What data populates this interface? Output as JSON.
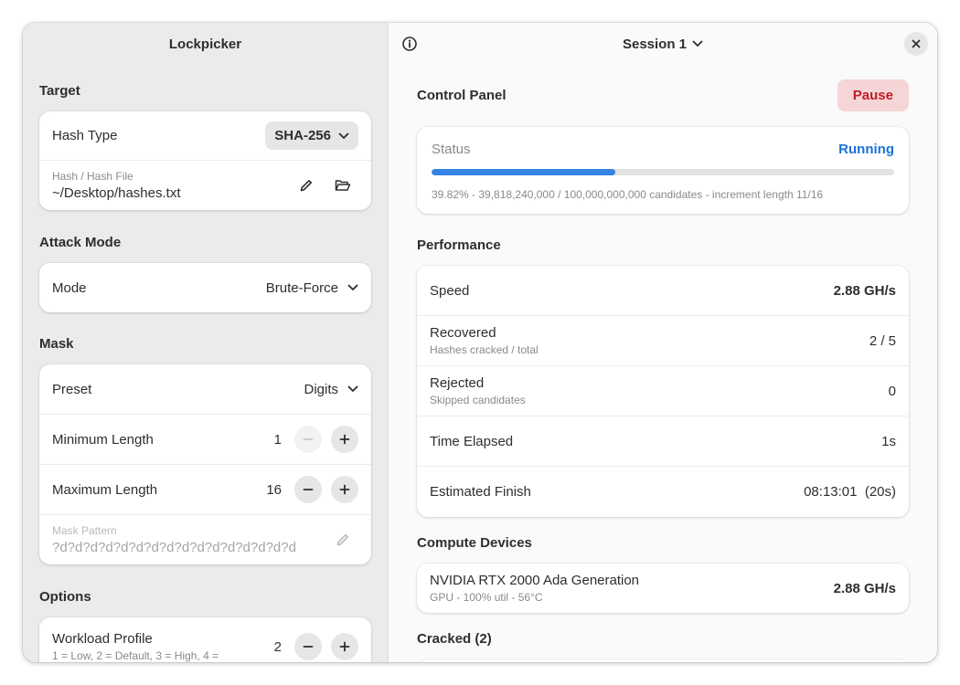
{
  "sidebar": {
    "title": "Lockpicker",
    "target": {
      "section_title": "Target",
      "hash_type_label": "Hash Type",
      "hash_type_value": "SHA-256",
      "hash_file_label": "Hash / Hash File",
      "hash_file_value": "~/Desktop/hashes.txt"
    },
    "attack": {
      "section_title": "Attack Mode",
      "mode_label": "Mode",
      "mode_value": "Brute-Force"
    },
    "mask": {
      "section_title": "Mask",
      "preset_label": "Preset",
      "preset_value": "Digits",
      "min_label": "Minimum Length",
      "min_value": "1",
      "max_label": "Maximum Length",
      "max_value": "16",
      "pattern_label": "Mask Pattern",
      "pattern_value": "?d?d?d?d?d?d?d?d?d?d?d?d?d?d?d?d"
    },
    "options": {
      "section_title": "Options",
      "workload_label": "Workload Profile",
      "workload_sub": "1 = Low, 2 = Default, 3 = High, 4 =",
      "workload_value": "2"
    }
  },
  "content": {
    "session_title": "Session 1",
    "control_panel": {
      "title": "Control Panel",
      "pause_label": "Pause",
      "status_label": "Status",
      "status_value": "Running",
      "progress_fraction": 0.3982,
      "progress_text": "39.82%  -  39,818,240,000 / 100,000,000,000 candidates  -  increment length 11/16"
    },
    "performance": {
      "title": "Performance",
      "speed_label": "Speed",
      "speed_value": "2.88 GH/s",
      "recovered_label": "Recovered",
      "recovered_sub": "Hashes cracked / total",
      "recovered_value": "2 / 5",
      "rejected_label": "Rejected",
      "rejected_sub": "Skipped candidates",
      "rejected_value": "0",
      "elapsed_label": "Time Elapsed",
      "elapsed_value": "1s",
      "finish_label": "Estimated Finish",
      "finish_value": "08:13:01  (20s)"
    },
    "devices": {
      "title": "Compute Devices",
      "device_name": "NVIDIA RTX 2000 Ada Generation",
      "device_sub": "GPU - 100% util - 56°C",
      "device_speed": "2.88 GH/s"
    },
    "cracked": {
      "title": "Cracked (2)"
    }
  },
  "colors": {
    "accent": "#1c71d8",
    "progress": "#3584e4",
    "destructive": "#c01c28",
    "destructive_bg": "#f5d5d6"
  },
  "icons": [
    "edit-icon",
    "folder-open-icon",
    "chevron-down-icon",
    "info-icon",
    "close-icon",
    "minus-icon",
    "plus-icon"
  ]
}
